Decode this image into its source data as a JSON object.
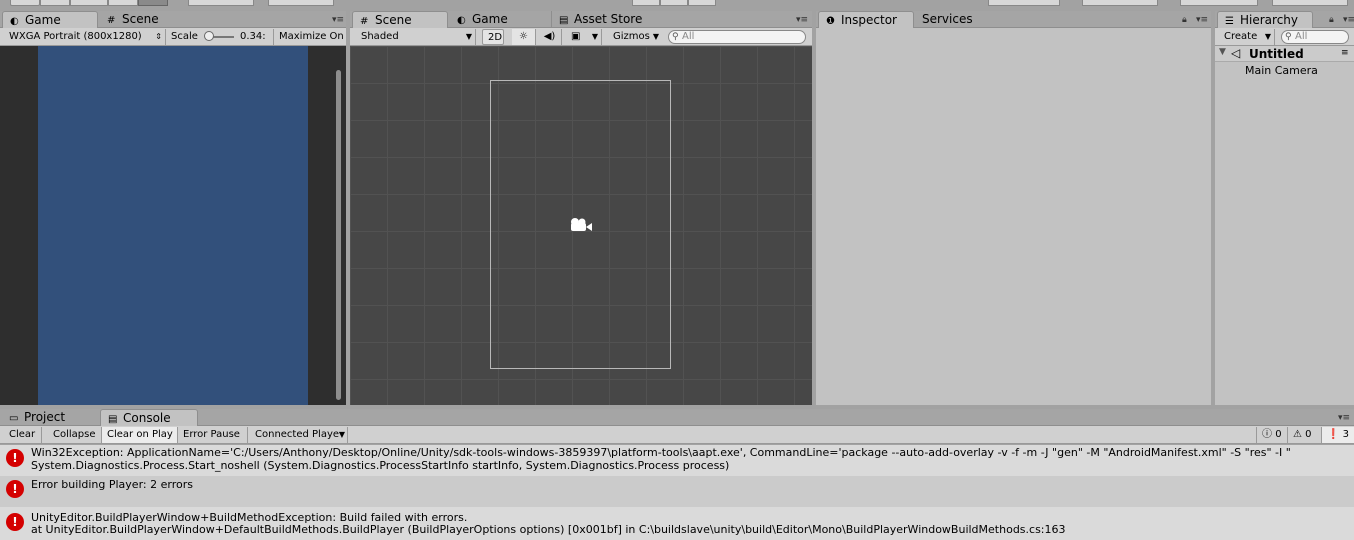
{
  "game_panel": {
    "tabs": [
      {
        "label": "Game"
      },
      {
        "label": "Scene"
      }
    ],
    "resolution": "WXGA Portrait (800x1280)",
    "scale_label": "Scale",
    "scale_value": "0.34:",
    "maximize": "Maximize On"
  },
  "scene_panel": {
    "tabs": [
      {
        "label": "Scene"
      },
      {
        "label": "Game"
      },
      {
        "label": "Asset Store"
      }
    ],
    "shading": "Shaded",
    "mode_2d": "2D",
    "gizmos": "Gizmos",
    "search_placeholder": "All"
  },
  "inspector_panel": {
    "tabs": [
      {
        "label": "Inspector"
      },
      {
        "label": "Services"
      }
    ]
  },
  "hierarchy_panel": {
    "tab": "Hierarchy",
    "create": "Create",
    "search_placeholder": "All",
    "scene_name": "Untitled",
    "items": [
      {
        "label": "Main Camera"
      }
    ]
  },
  "console_panel": {
    "tabs": [
      {
        "label": "Project"
      },
      {
        "label": "Console"
      }
    ],
    "buttons": {
      "clear": "Clear",
      "collapse": "Collapse",
      "clear_on_play": "Clear on Play",
      "error_pause": "Error Pause",
      "connected_player": "Connected Playe"
    },
    "counts": {
      "log": "0",
      "warning": "0",
      "error": "3"
    },
    "messages": [
      {
        "line1": "Win32Exception: ApplicationName='C:/Users/Anthony/Desktop/Online/Unity/sdk-tools-windows-3859397\\platform-tools\\aapt.exe', CommandLine='package --auto-add-overlay -v -f -m -J \"gen\" -M \"AndroidManifest.xml\" -S \"res\" -I \"",
        "line2": "System.Diagnostics.Process.Start_noshell (System.Diagnostics.ProcessStartInfo startInfo, System.Diagnostics.Process process)"
      },
      {
        "line1": "Error building Player: 2 errors",
        "line2": ""
      },
      {
        "line1": "UnityEditor.BuildPlayerWindow+BuildMethodException: Build failed with errors.",
        "line2": "  at UnityEditor.BuildPlayerWindow+DefaultBuildMethods.BuildPlayer (BuildPlayerOptions options) [0x001bf] in C:\\buildslave\\unity\\build\\Editor\\Mono\\BuildPlayerWindowBuildMethods.cs:163"
      }
    ]
  },
  "colors": {
    "game_view": "#32507b",
    "scene_bg": "#474747",
    "error_red": "#d40000",
    "panel_gray": "#c2c2c2"
  }
}
